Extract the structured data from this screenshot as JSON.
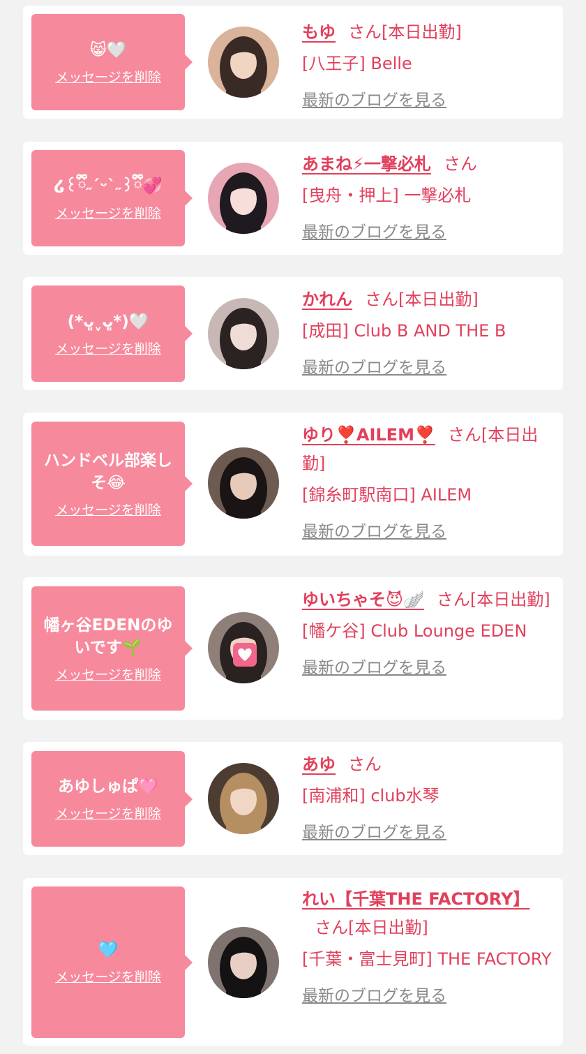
{
  "colors": {
    "accent": "#e23f5b",
    "bubble": "#f7899c",
    "card": "#ffffff",
    "background": "#f2f2f2",
    "blog_link": "#8a8a8a"
  },
  "delete_label": "メッセージを削除",
  "blog_label": "最新のブログを見る",
  "items": [
    {
      "message": "😸🤍",
      "name": "もゆ",
      "suffix": "さん[本日出勤]",
      "shop": "[八王子] Belle",
      "avatar_icon": "avatar-photo"
    },
    {
      "message": "໒꒰ྀི˶ˊᵕˋ˶꒱ྀི💞",
      "name": "あまね⚡一撃必札",
      "suffix": "さん",
      "shop": "[曳舟・押上] 一撃必札",
      "avatar_icon": "avatar-photo"
    },
    {
      "message": "(*ᴗ͈ˬᴗ͈*)🤍",
      "name": "かれん",
      "suffix": "さん[本日出勤]",
      "shop": "[成田] Club B AND THE B",
      "avatar_icon": "avatar-photo"
    },
    {
      "message": "ハンドベル部楽しそ😂",
      "name": "ゆり❣️AILEM❣️",
      "suffix": "さん[本日出勤]",
      "shop": "[錦糸町駅南口] AILEM",
      "avatar_icon": "avatar-photo"
    },
    {
      "message": "幡ヶ谷EDENのゆいです🌱",
      "name": "ゆいちゃそ😈🪽",
      "suffix": "さん[本日出勤]",
      "shop": "[幡ケ谷] Club Lounge EDEN",
      "avatar_icon": "avatar-photo"
    },
    {
      "message": "あゆしゅぱ🩷",
      "name": "あゆ",
      "suffix": "さん",
      "shop": "[南浦和] club水琴",
      "avatar_icon": "avatar-photo"
    },
    {
      "message": "🩵",
      "name": "れい【千葉THE FACTORY】",
      "suffix": "さん[本日出勤]",
      "shop": "[千葉・富士見町] THE FACTORY",
      "avatar_icon": "avatar-photo"
    }
  ]
}
